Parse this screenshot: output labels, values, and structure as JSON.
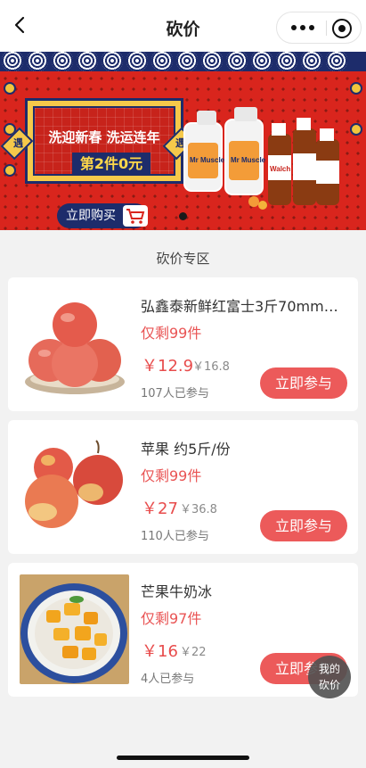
{
  "header": {
    "title": "砍价"
  },
  "banner": {
    "promo_line1": "洗迎新春 洗运连年",
    "promo_line2": "第2件0元",
    "tag_left": "遇",
    "tag_right": "遇",
    "buy_label": "立即购买",
    "brand_labels": [
      "Mr Muscle",
      "Walch"
    ]
  },
  "section_title": "砍价专区",
  "products": [
    {
      "name": "弘鑫泰新鲜红富士3斤70mm…",
      "remain": "仅剩99件",
      "price": "￥12.9",
      "original": "￥16.8",
      "joined": "107人已参与",
      "button": "立即参与"
    },
    {
      "name": "苹果 约5斤/份",
      "remain": "仅剩99件",
      "price": "￥27",
      "original": "￥36.8",
      "joined": "110人已参与",
      "button": "立即参与"
    },
    {
      "name": "芒果牛奶冰",
      "remain": "仅剩97件",
      "price": "￥16",
      "original": "￥22",
      "joined": "4人已参与",
      "button": "立即参与"
    }
  ],
  "floating": {
    "line1": "我的",
    "line2": "砍价"
  },
  "colors": {
    "accent": "#ec5a5a",
    "price": "#e84c4c",
    "banner_red": "#d9251d",
    "banner_navy": "#1d2c6b"
  }
}
